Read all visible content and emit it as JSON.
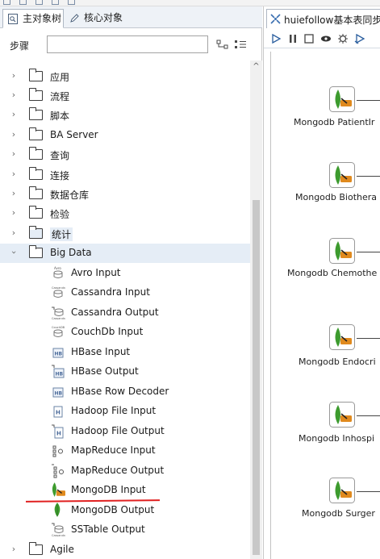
{
  "left_panel": {
    "tabs": [
      {
        "label": "主对象树",
        "active": true
      },
      {
        "label": "核心对象",
        "active": false
      }
    ],
    "step_label": "步骤",
    "search": {
      "value": "",
      "placeholder": ""
    },
    "tree": [
      {
        "label": "应用",
        "expanded": false
      },
      {
        "label": "流程",
        "expanded": false
      },
      {
        "label": "脚本",
        "expanded": false
      },
      {
        "label": "BA Server",
        "expanded": false
      },
      {
        "label": "查询",
        "expanded": false
      },
      {
        "label": "连接",
        "expanded": false
      },
      {
        "label": "数据仓库",
        "expanded": false
      },
      {
        "label": "检验",
        "expanded": false
      },
      {
        "label": "统计",
        "expanded": false
      },
      {
        "label": "Big Data",
        "expanded": true
      }
    ],
    "big_data_children": [
      {
        "label": "Avro Input",
        "icon": "avro-input-icon"
      },
      {
        "label": "Cassandra Input",
        "icon": "cassandra-input-icon"
      },
      {
        "label": "Cassandra Output",
        "icon": "cassandra-output-icon"
      },
      {
        "label": "CouchDb Input",
        "icon": "couchdb-input-icon"
      },
      {
        "label": "HBase Input",
        "icon": "hbase-input-icon"
      },
      {
        "label": "HBase Output",
        "icon": "hbase-output-icon"
      },
      {
        "label": "HBase Row Decoder",
        "icon": "hbase-row-decoder-icon"
      },
      {
        "label": "Hadoop File Input",
        "icon": "hadoop-file-input-icon"
      },
      {
        "label": "Hadoop File Output",
        "icon": "hadoop-file-output-icon"
      },
      {
        "label": "MapReduce Input",
        "icon": "mapreduce-input-icon"
      },
      {
        "label": "MapReduce Output",
        "icon": "mapreduce-output-icon"
      },
      {
        "label": "MongoDB Input",
        "icon": "mongodb-input-icon"
      },
      {
        "label": "MongoDB Output",
        "icon": "mongodb-output-icon"
      },
      {
        "label": "SSTable Output",
        "icon": "sstable-output-icon"
      }
    ],
    "after_tree": [
      {
        "label": "Agile",
        "expanded": false
      }
    ]
  },
  "right_panel": {
    "tab_title": "huiefollow基本表同步",
    "nodes": [
      {
        "label": "Mongodb PatientIr"
      },
      {
        "label": "Mongodb Biothera"
      },
      {
        "label": "Mongodb Chemothe"
      },
      {
        "label": "Mongodb Endocri"
      },
      {
        "label": "Mongodb Inhospi"
      },
      {
        "label": "Mongodb Surger"
      }
    ]
  },
  "colors": {
    "selection_bg": "#e5edf6",
    "mongo_green": "#3d9b2e",
    "arrow_orange": "#e08a1e",
    "annotation_red": "#e02020"
  }
}
